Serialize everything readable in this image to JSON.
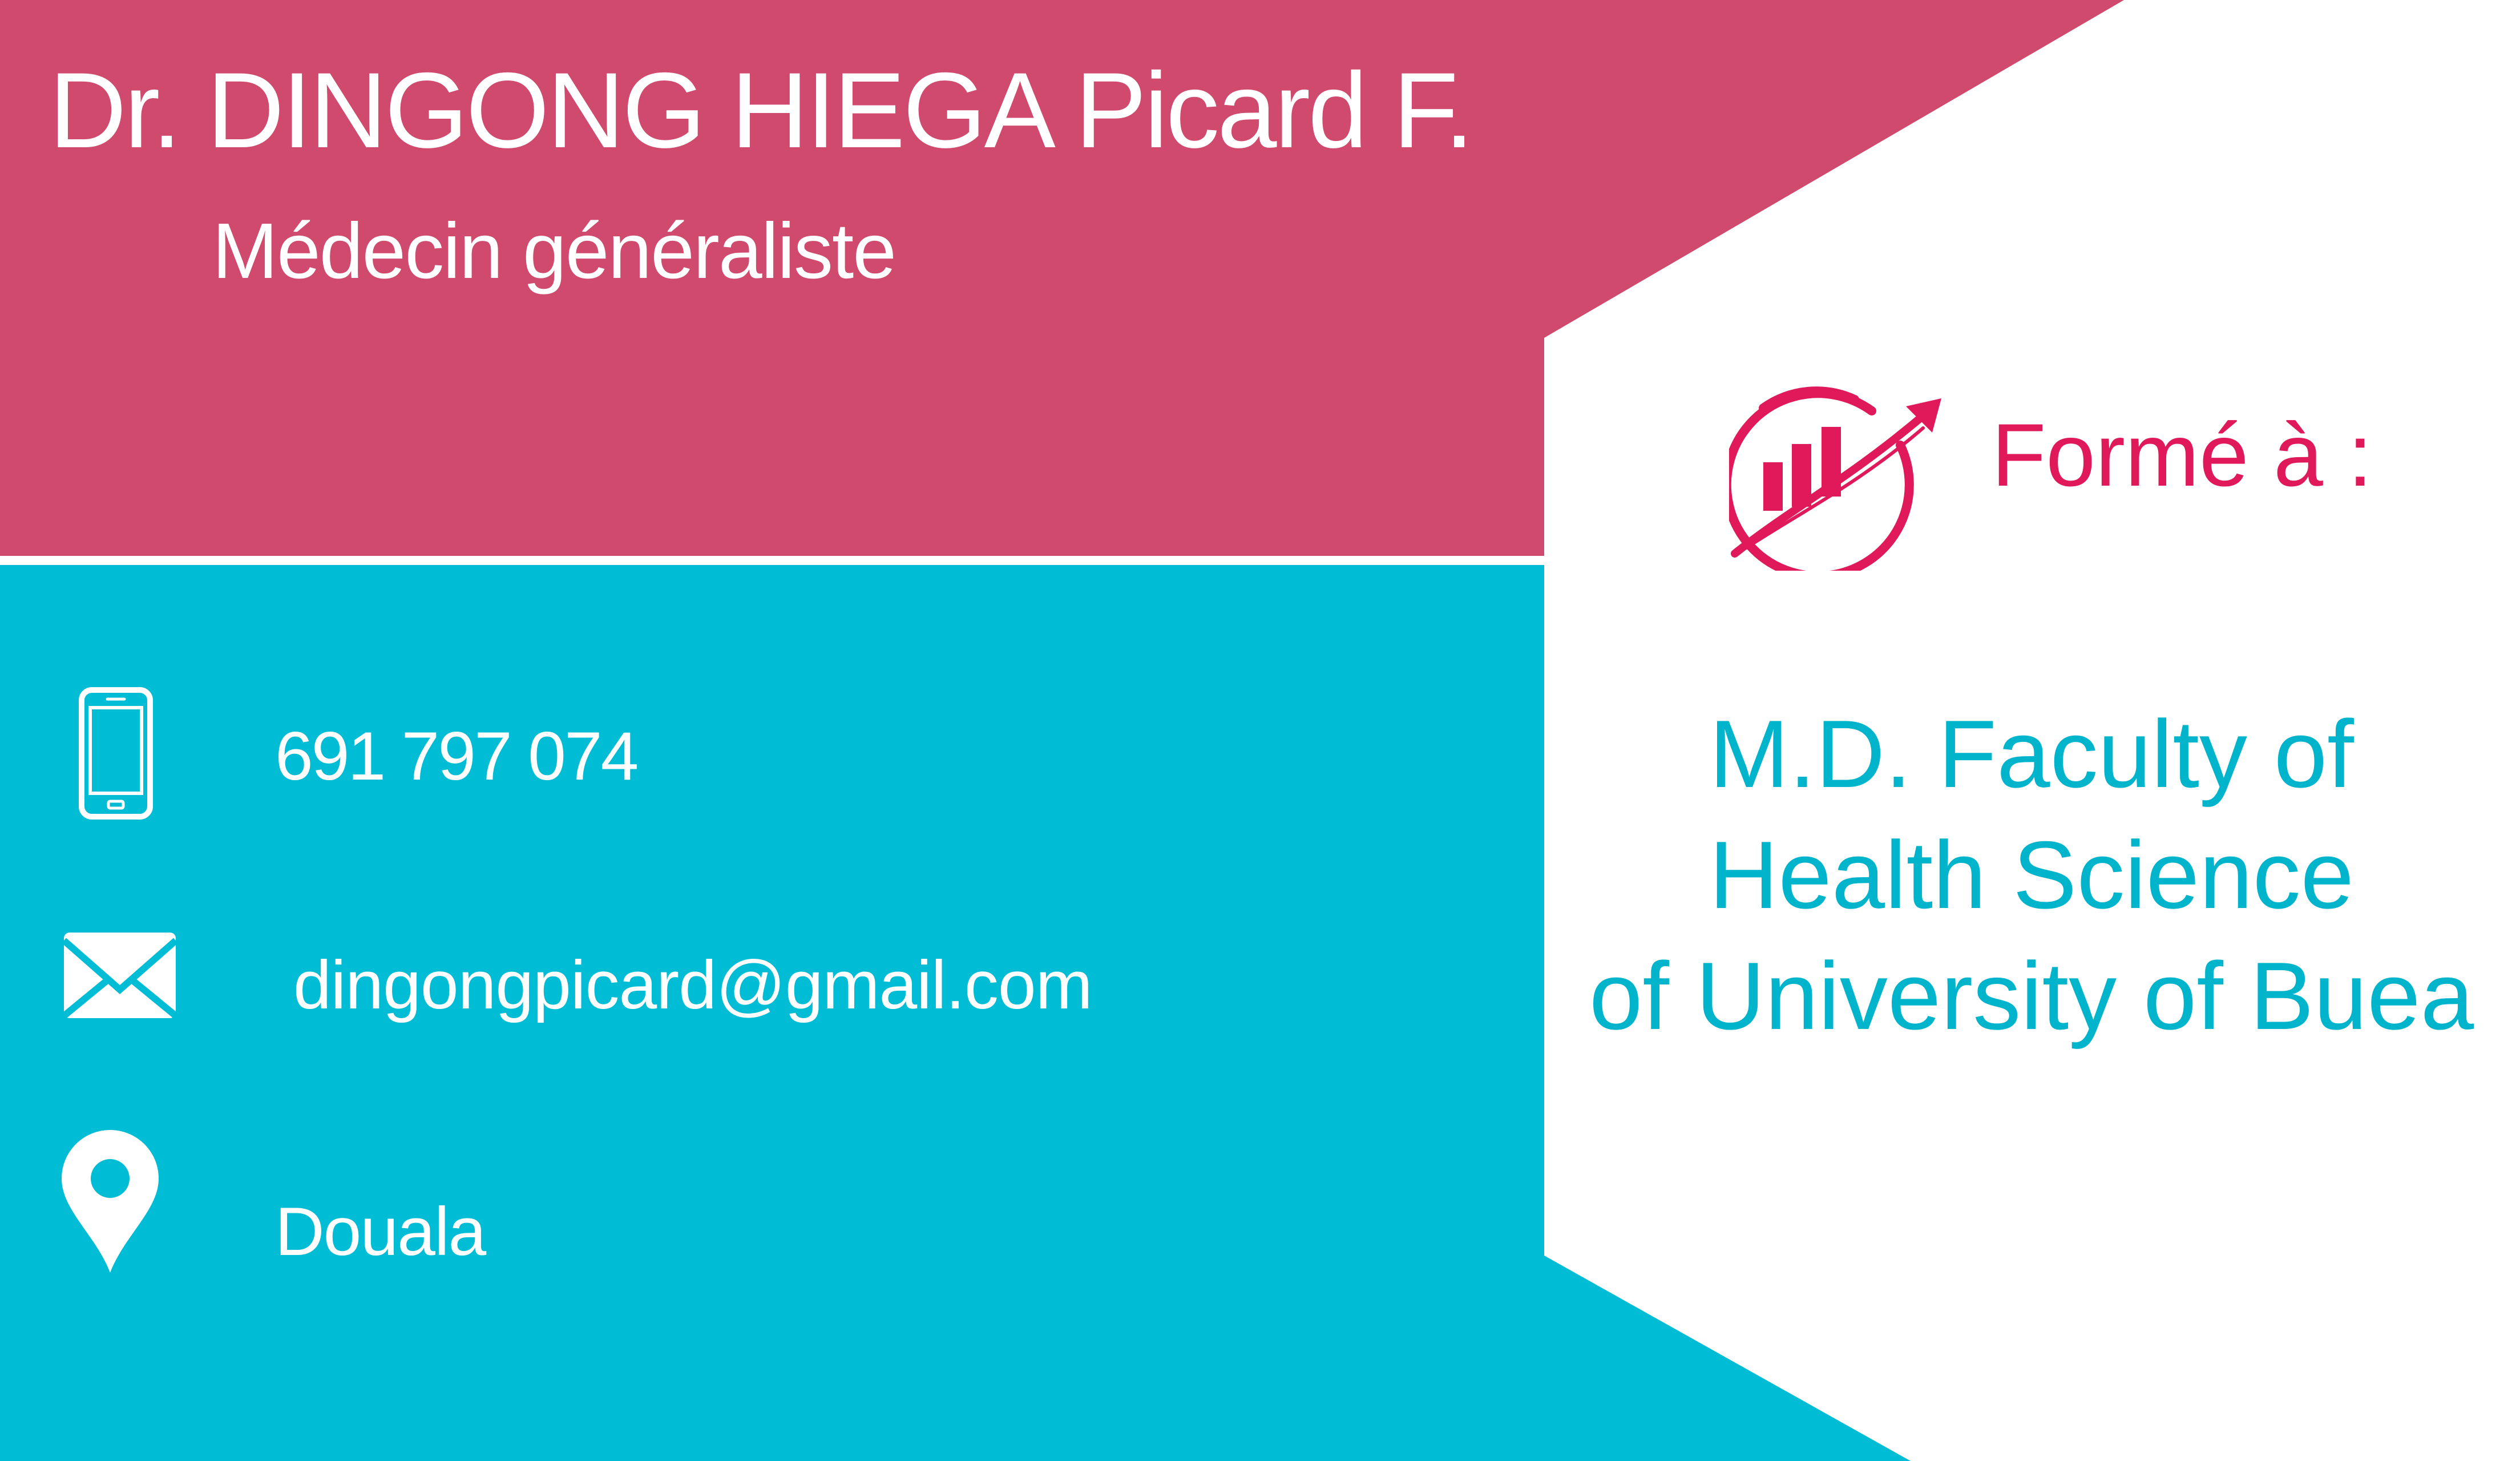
{
  "card": {
    "name": "Dr. DINGONG HIEGA Picard F.",
    "specialty": "Médecin généraliste",
    "contact": {
      "phone": "691 797 074",
      "email": "dingongpicard@gmail.com",
      "city": "Douala"
    },
    "training": {
      "label": "Formé à :",
      "lines": [
        "M.D. Faculty of",
        "Health Science",
        "of University of Buea"
      ]
    }
  },
  "icons": {
    "phone": "smartphone-icon",
    "email": "envelope-icon",
    "city": "map-pin-icon",
    "training": "growth-chart-icon"
  },
  "colors": {
    "top_band": "#d04a6e",
    "bottom_band": "#00bcd4",
    "accent_pink": "#e0195a",
    "accent_teal": "#00b4cc",
    "background": "#ffffff"
  }
}
